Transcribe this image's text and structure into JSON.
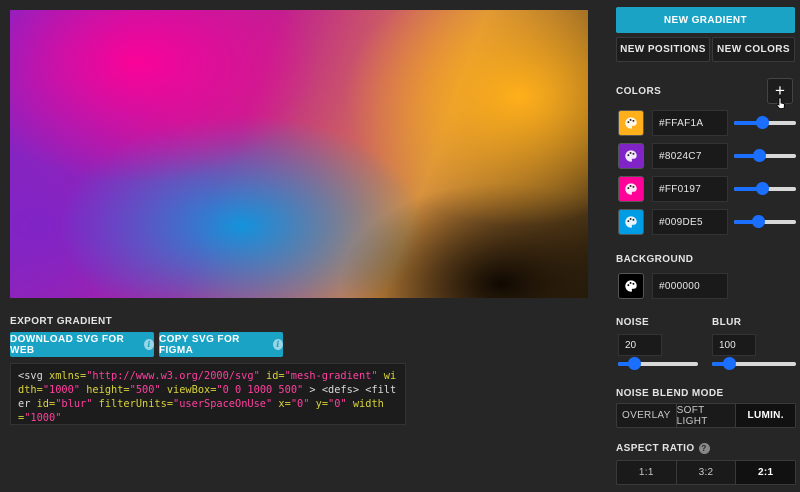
{
  "export": {
    "label": "EXPORT GRADIENT",
    "download_label": "DOWNLOAD SVG FOR WEB",
    "copy_label": "COPY SVG FOR FIGMA",
    "code": {
      "t1": "<svg ",
      "a1": "xmlns=",
      "s1": "\"http://www.w3.org/2000/svg\"",
      "a2": " id=",
      "s2": "\"mesh-gradient\"",
      "a3": " width=",
      "s3": "\"1000\"",
      "a4": " height=",
      "s4": "\"500\"",
      "a5": " viewBox=",
      "s5": "\"0 0 1000 500\"",
      "t2": " > <defs> <filter ",
      "a6": "id=",
      "s6": "\"blur\"",
      "a7": " filterUnits=",
      "s7": "\"userSpaceOnUse\"",
      "a8": " x=",
      "s8": "\"0\"",
      "a9": " y=",
      "s9": "\"0\"",
      "a10": " width=",
      "s10": "\"1000\""
    }
  },
  "toolbar": {
    "new_gradient": "NEW GRADIENT",
    "new_positions": "NEW POSITIONS",
    "new_colors": "NEW COLORS"
  },
  "colors": {
    "label": "COLORS",
    "add_label": "+",
    "items": [
      {
        "hex": "#FFAF1A",
        "swatch": "#ffaf1a",
        "value": 0.45
      },
      {
        "hex": "#8024C7",
        "swatch": "#8024c7",
        "value": 0.4
      },
      {
        "hex": "#FF0197",
        "swatch": "#ff0197",
        "value": 0.45
      },
      {
        "hex": "#009DE5",
        "swatch": "#009de5",
        "value": 0.38
      }
    ]
  },
  "background": {
    "label": "BACKGROUND",
    "hex": "#000000",
    "swatch": "#000000"
  },
  "noise": {
    "label": "NOISE",
    "value": "20",
    "level": 0.2
  },
  "blur": {
    "label": "BLUR",
    "value": "100",
    "level": 0.2
  },
  "blend": {
    "label": "NOISE BLEND MODE",
    "options": [
      "OVERLAY",
      "SOFT LIGHT",
      "LUMIN."
    ],
    "selected": 2
  },
  "aspect": {
    "label": "ASPECT RATIO",
    "help": "?",
    "options": [
      "1:1",
      "3:2",
      "2:1"
    ],
    "selected": 2
  },
  "accent": "#1ba3c6"
}
